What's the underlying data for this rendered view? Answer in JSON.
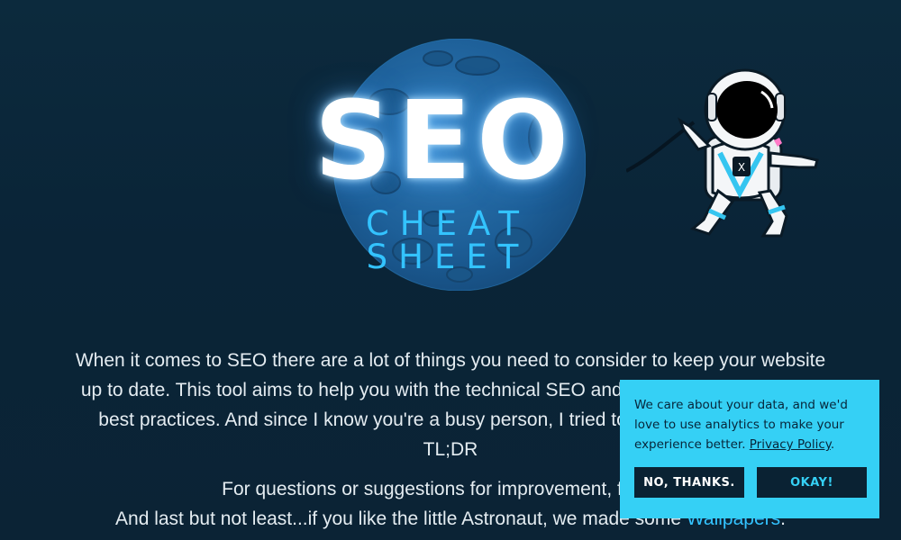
{
  "hero": {
    "title": "SEO",
    "subtitle": "CHEAT SHEET",
    "moon_icon": "moon-icon",
    "astronaut_icon": "astronaut-icon"
  },
  "intro": {
    "paragraph1": "When it comes to SEO there are a lot of things you need to consider to keep your website up to date. This tool aims to help you with the technical SEO and includes a sorted list of best practices. And since I know you're a busy person, I tried to implement them in a TL;DR",
    "paragraph2_line1": "For questions or suggestions for improvement, find me",
    "paragraph2_line2_prefix": "And last but not least...if you like the little Astronaut, we made some ",
    "wallpapers_link": "Wallpapers",
    "paragraph2_line2_suffix": "."
  },
  "cookie_banner": {
    "text": "We care about your data, and we'd love to use analytics to make your experience better.",
    "privacy_link": "Privacy Policy",
    "after_link": ".",
    "decline_label": "NO, THANKS.",
    "accept_label": "OKAY!"
  },
  "colors": {
    "background": "#0b2537",
    "accent": "#33c3ff",
    "banner": "#35d0f5",
    "button_bg": "#0a2233"
  }
}
